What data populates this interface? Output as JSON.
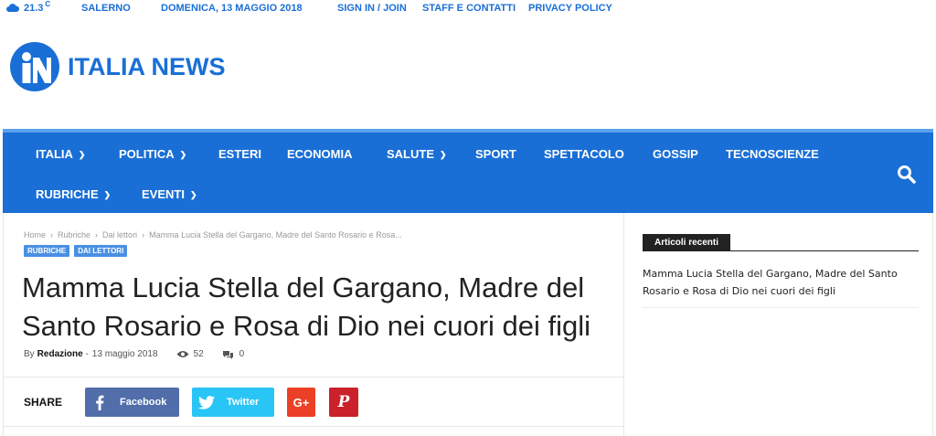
{
  "topbar": {
    "temperature": "21.3",
    "degree": "C",
    "city": "SALERNO",
    "date": "DOMENICA, 13 MAGGIO 2018",
    "links": [
      "SIGN IN / JOIN",
      "STAFF E CONTATTI",
      "PRIVACY POLICY"
    ]
  },
  "logo": {
    "text": "ITALIA NEWS"
  },
  "colors": {
    "brand": "#1a6fd6",
    "tag": "#4a90e2",
    "facebook": "#516eab",
    "twitter": "#29c5f6",
    "googleplus": "#eb4026",
    "pinterest": "#ca212a"
  },
  "nav": {
    "row1": [
      {
        "label": "ITALIA",
        "dropdown": true
      },
      {
        "label": "POLITICA",
        "dropdown": true
      },
      {
        "label": "ESTERI",
        "dropdown": false
      },
      {
        "label": "ECONOMIA",
        "dropdown": false
      },
      {
        "label": "SALUTE",
        "dropdown": true
      },
      {
        "label": "SPORT",
        "dropdown": false
      },
      {
        "label": "SPETTACOLO",
        "dropdown": false
      },
      {
        "label": "GOSSIP",
        "dropdown": false
      },
      {
        "label": "TECNOSCIENZE",
        "dropdown": false
      }
    ],
    "row2": [
      {
        "label": "RUBRICHE",
        "dropdown": true
      },
      {
        "label": "EVENTI",
        "dropdown": true
      }
    ],
    "search_icon": "search-icon"
  },
  "article": {
    "breadcrumb": [
      "Home",
      "Rubriche",
      "Dai lettori",
      "Mamma Lucia Stella del Gargano, Madre del Santo Rosario e Rosa..."
    ],
    "tags": [
      "RUBRICHE",
      "DAI LETTORI"
    ],
    "title": "Mamma Lucia Stella del Gargano, Madre del Santo Rosario e Rosa di Dio nei cuori dei figli",
    "by": "By",
    "author": "Redazione",
    "date": "13 maggio 2018",
    "views": "52",
    "comments": "0"
  },
  "share": {
    "label": "SHARE",
    "facebook": "Facebook",
    "twitter": "Twitter",
    "googleplus": "G+",
    "pinterest": "P"
  },
  "sidebar": {
    "heading": "Articoli recenti",
    "posts": [
      "Mamma Lucia Stella del Gargano, Madre del Santo Rosario e Rosa di Dio nei cuori dei figli"
    ]
  }
}
